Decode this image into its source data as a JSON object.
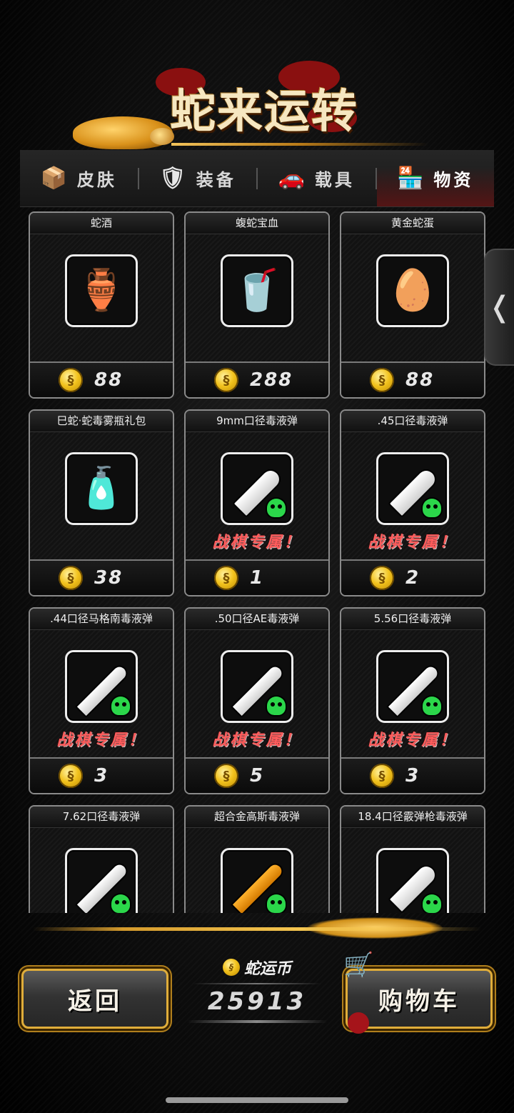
{
  "header": {
    "title": "蛇来运转"
  },
  "tabs": [
    {
      "label": "皮肤",
      "icon": "box-icon",
      "active": false
    },
    {
      "label": "装备",
      "icon": "shield-icon",
      "active": false
    },
    {
      "label": "载具",
      "icon": "car-icon",
      "active": false
    },
    {
      "label": "物资",
      "icon": "shop-icon",
      "active": true
    }
  ],
  "items": [
    {
      "name": "蛇酒",
      "icon": "snake-wine-jar-icon",
      "glyph": "🏺",
      "price": "88",
      "exclusive": ""
    },
    {
      "name": "蝮蛇宝血",
      "icon": "snake-blood-cup-icon",
      "glyph": "🥤",
      "price": "288",
      "exclusive": ""
    },
    {
      "name": "黄金蛇蛋",
      "icon": "snake-eggs-icon",
      "glyph": "🥚",
      "price": "88",
      "exclusive": ""
    },
    {
      "name": "巳蛇·蛇毒雾瓶礼包",
      "icon": "venom-spray-bottle-icon",
      "glyph": "🧴",
      "price": "38",
      "exclusive": ""
    },
    {
      "name": "9mm口径毒液弹",
      "icon": "bullet-9mm-icon",
      "price": "1",
      "exclusive": "战棋专属！"
    },
    {
      "name": ".45口径毒液弹",
      "icon": "bullet-45-icon",
      "price": "2",
      "exclusive": "战棋专属！"
    },
    {
      "name": ".44口径马格南毒液弹",
      "icon": "bullet-44-magnum-icon",
      "price": "3",
      "exclusive": "战棋专属！"
    },
    {
      "name": ".50口径AE毒液弹",
      "icon": "bullet-50ae-icon",
      "price": "5",
      "exclusive": "战棋专属！"
    },
    {
      "name": "5.56口径毒液弹",
      "icon": "bullet-556-icon",
      "price": "3",
      "exclusive": "战棋专属！"
    },
    {
      "name": "7.62口径毒液弹",
      "icon": "bullet-762-icon",
      "price": "",
      "exclusive": ""
    },
    {
      "name": "超合金高斯毒液弹",
      "icon": "gauss-bullet-icon",
      "price": "",
      "exclusive": ""
    },
    {
      "name": "18.4口径霰弹枪毒液弹",
      "icon": "shotgun-shell-icon",
      "price": "",
      "exclusive": ""
    }
  ],
  "footer": {
    "back_label": "返回",
    "cart_label": "购物车",
    "currency_label": "蛇运币",
    "currency_value": "25913"
  },
  "colors": {
    "accent_gold": "#e0ad3a",
    "exclusive_red": "#ff5d5d",
    "poison_green": "#2bd64a"
  }
}
